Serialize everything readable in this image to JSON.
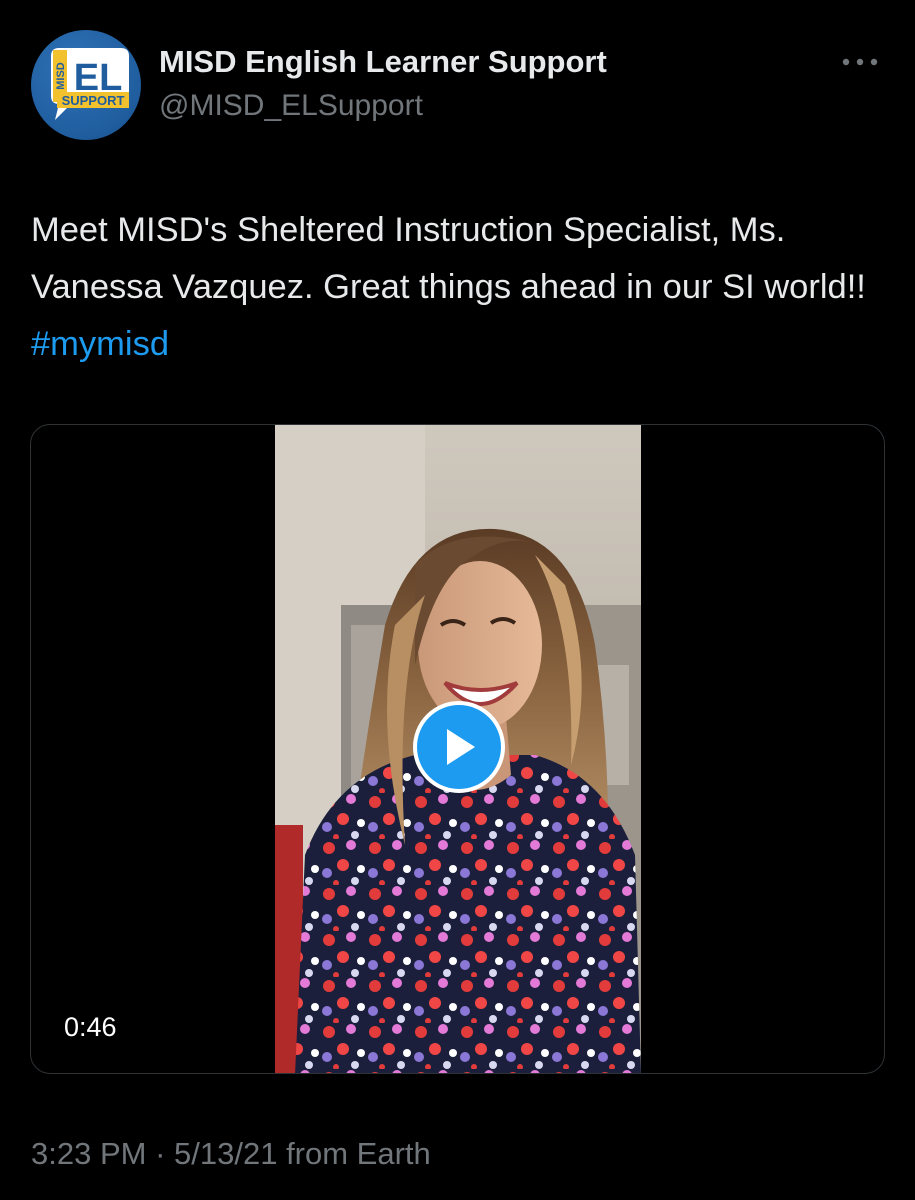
{
  "author": {
    "display_name": "MISD English Learner Support",
    "handle": "@MISD_ELSupport",
    "avatar": {
      "icon": "el-support-logo",
      "side_text": "MISD",
      "main_text": "EL",
      "banner_text": "SUPPORT"
    }
  },
  "more_icon": "more-horizontal-icon",
  "tweet": {
    "text_part1": "Meet MISD's Sheltered Instruction Specialist, Ms. Vanessa Vazquez. Great things ahead in our SI world!! ",
    "hashtag": "#mymisd"
  },
  "media": {
    "type": "video",
    "duration": "0:46",
    "play_icon": "play-icon"
  },
  "meta": {
    "time": "3:23 PM",
    "separator": " · ",
    "date": "5/13/21",
    "source": " from Earth"
  },
  "colors": {
    "background": "#000000",
    "text_primary": "#e7e9ea",
    "text_secondary": "#71767b",
    "accent": "#1d9bf0"
  }
}
